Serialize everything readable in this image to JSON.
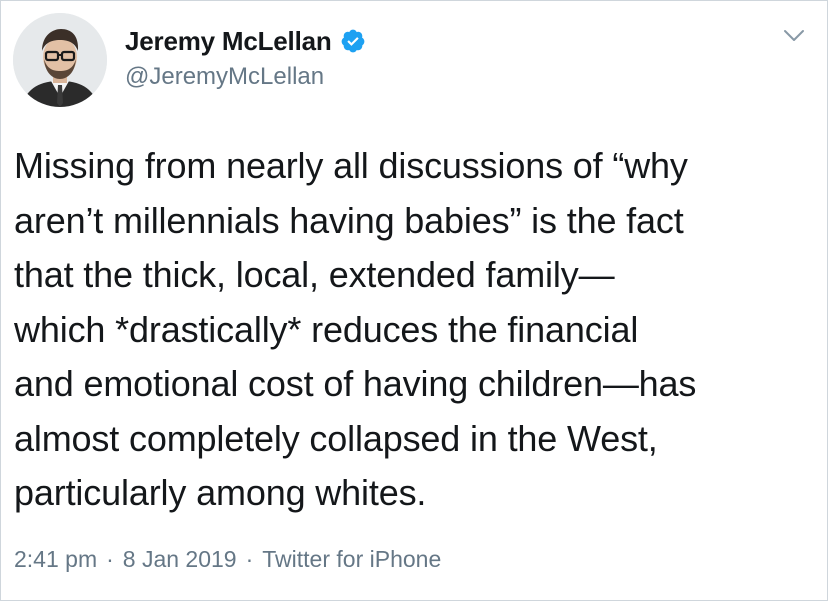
{
  "tweet": {
    "display_name": "Jeremy McLellan",
    "handle": "@JeremyMcLellan",
    "verified": true,
    "verified_icon": "verified-badge-icon",
    "menu_icon": "chevron-down-icon",
    "text": "Missing from nearly all discussions of “why\naren’t millennials having babies” is the fact\nthat the thick, local, extended family—\nwhich *drastically* reduces the financial\nand emotional cost of having children—has\nalmost completely collapsed in the West,\nparticularly among whites.",
    "time": "2:41 pm",
    "date": "8 Jan 2019",
    "source": "Twitter for iPhone",
    "separator": "·"
  },
  "colors": {
    "text": "#14171a",
    "secondary": "#657786",
    "verified": "#1da1f2",
    "border": "#cfd6dc"
  }
}
